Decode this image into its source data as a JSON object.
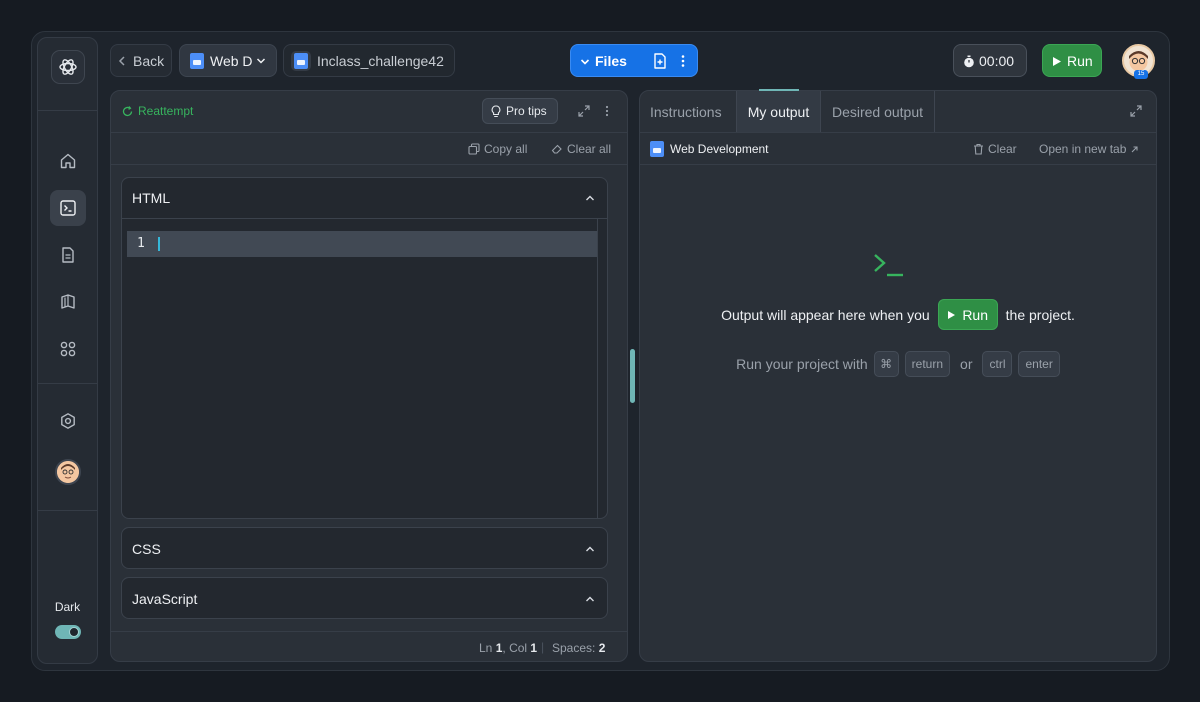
{
  "topbar": {
    "back_label": "Back",
    "course_label": "Web D",
    "project_label": "Inclass_challenge42",
    "files_label": "Files",
    "timer": "00:00",
    "run_label": "Run",
    "avatar_badge": "15"
  },
  "sidebar": {
    "items": [
      {
        "icon": "home-icon"
      },
      {
        "icon": "terminal-icon",
        "active": true
      },
      {
        "icon": "document-icon"
      },
      {
        "icon": "book-icon"
      },
      {
        "icon": "apps-icon"
      },
      {
        "icon": "settings-icon"
      }
    ],
    "dark_label": "Dark",
    "dark_mode": true
  },
  "editor": {
    "reattempt_label": "Reattempt",
    "pro_tips_label": "Pro tips",
    "copy_all_label": "Copy all",
    "clear_all_label": "Clear all",
    "sections": {
      "html": "HTML",
      "css": "CSS",
      "js": "JavaScript"
    },
    "line_number": "1",
    "status": {
      "ln_label": "Ln",
      "ln_value": "1",
      "col_label": "Col",
      "col_value": "1",
      "spaces_label": "Spaces:",
      "spaces_value": "2"
    }
  },
  "output": {
    "tabs": [
      "Instructions",
      "My output",
      "Desired output"
    ],
    "active_tab": "My output",
    "source_label": "Web Development",
    "clear_label": "Clear",
    "open_new_tab_label": "Open in new tab",
    "message_before": "Output will appear here when you",
    "message_run": "Run",
    "message_after": "the project.",
    "shortcut_text": "Run your project with",
    "shortcut_keys": [
      "⌘",
      "return"
    ],
    "shortcut_or": "or",
    "shortcut_keys_alt": [
      "ctrl",
      "enter"
    ]
  },
  "colors": {
    "accent_blue": "#1672e6",
    "run_green": "#2f8f45",
    "reattempt_green": "#37b45e",
    "teal": "#6fb6b6"
  }
}
